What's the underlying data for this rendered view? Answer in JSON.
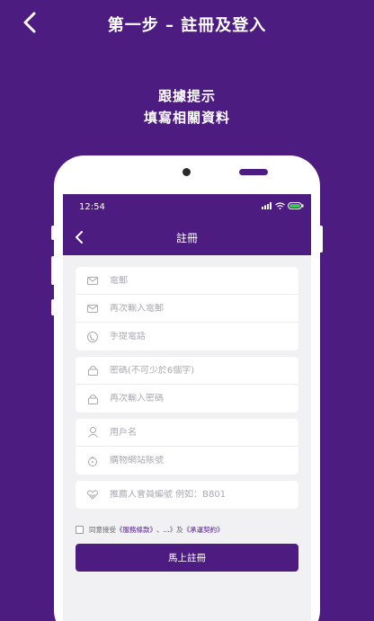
{
  "header": {
    "title": "第一步 – 註冊及登入"
  },
  "hint": {
    "line1": "跟據提示",
    "line2": "填寫相關資料"
  },
  "phone": {
    "status": {
      "time": "12:54"
    },
    "appbar": {
      "title": "註冊"
    },
    "form": {
      "email": {
        "placeholder": "電郵"
      },
      "email_confirm": {
        "placeholder": "再次輸入電郵"
      },
      "mobile": {
        "placeholder": "手提電話"
      },
      "password": {
        "placeholder": "密碼(不可少於6個字)"
      },
      "password_confirm": {
        "placeholder": "再次輸入密碼"
      },
      "username": {
        "placeholder": "用戶名"
      },
      "shop_account": {
        "placeholder": "購物網站賬號"
      },
      "referrer": {
        "placeholder": "推薦人會員編號 例如：B801"
      }
    },
    "agree": {
      "prefix": "同意接受",
      "terms": "《服務條款》",
      "ellipsis": "、...",
      "conjunction": "》及",
      "contract": "《承運契約》"
    },
    "submit_label": "馬上註冊"
  },
  "colors": {
    "brand": "#4d1c80",
    "background": "#f1f1f4"
  }
}
